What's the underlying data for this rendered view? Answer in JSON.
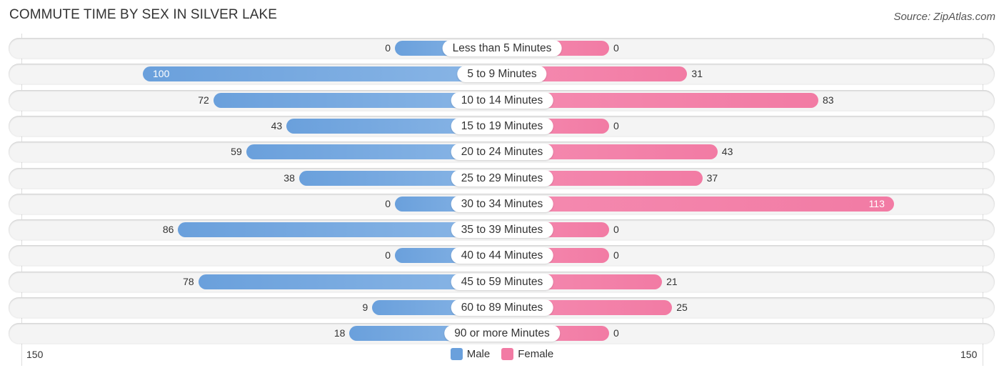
{
  "header": {
    "title": "COMMUTE TIME BY SEX IN SILVER LAKE",
    "source": "Source: ZipAtlas.com"
  },
  "colors": {
    "male": "#6aa0dc",
    "female": "#f27ba4"
  },
  "chart_data": {
    "type": "bar",
    "orientation": "horizontal-diverging",
    "title": "COMMUTE TIME BY SEX IN SILVER LAKE",
    "categories": [
      "Less than 5 Minutes",
      "5 to 9 Minutes",
      "10 to 14 Minutes",
      "15 to 19 Minutes",
      "20 to 24 Minutes",
      "25 to 29 Minutes",
      "30 to 34 Minutes",
      "35 to 39 Minutes",
      "40 to 44 Minutes",
      "45 to 59 Minutes",
      "60 to 89 Minutes",
      "90 or more Minutes"
    ],
    "series": [
      {
        "name": "Male",
        "values": [
          0,
          100,
          72,
          43,
          59,
          38,
          0,
          86,
          0,
          78,
          9,
          18
        ]
      },
      {
        "name": "Female",
        "values": [
          0,
          31,
          83,
          0,
          43,
          37,
          113,
          0,
          0,
          21,
          25,
          0
        ]
      }
    ],
    "axis": {
      "left_label": "150",
      "right_label": "150",
      "range": [
        -150,
        150
      ]
    },
    "legend": {
      "position": "bottom-center",
      "items": [
        "Male",
        "Female"
      ]
    },
    "grid": false
  }
}
